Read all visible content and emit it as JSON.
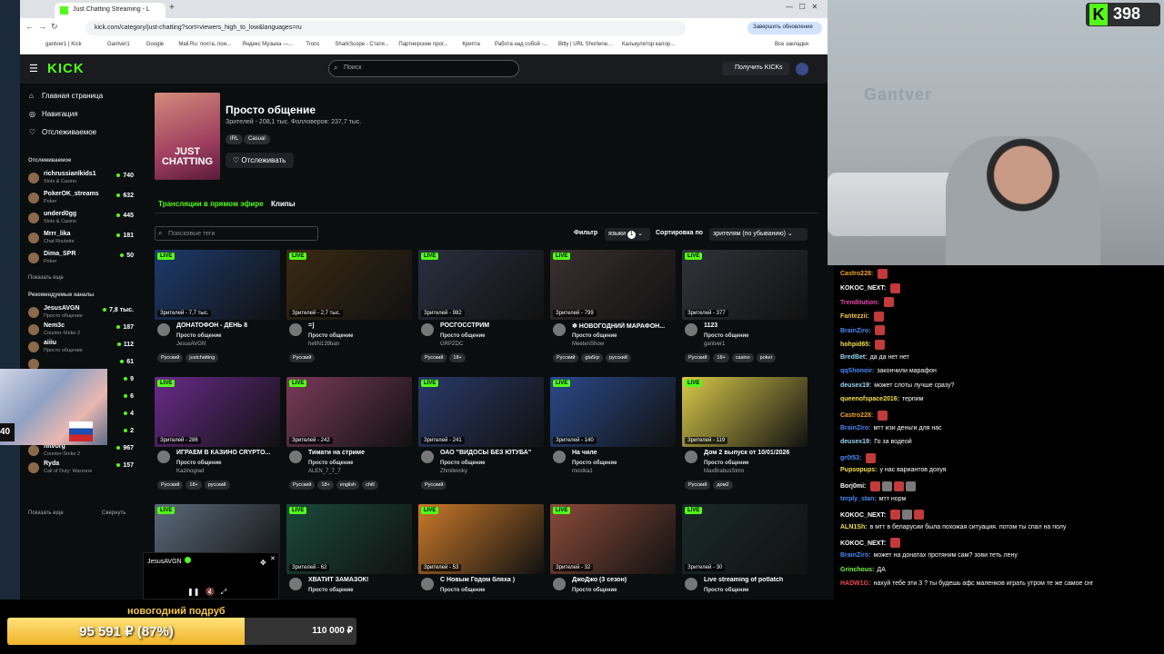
{
  "browser": {
    "tab_title": "Just Chatting Streaming - L",
    "url": "kick.com/category/just-chatting?sort=viewers_high_to_low&languages=ru",
    "update_btn": "Завершить обновление",
    "bookmarks": [
      "gantver1 | Kick",
      "Gantver1",
      "Google",
      "Mail.Ru: почта, пои...",
      "Яндекс Музыка —...",
      "Tronc",
      "SharkScope - Стати...",
      "Партнерские прог...",
      "Крипта",
      "Работа над собой -...",
      "Bitly | URL Shortene...",
      "Калькулятор калор...",
      "Все закладки"
    ]
  },
  "kick": {
    "logo": "KICK",
    "search_placeholder": "Поиск",
    "get_kicks": "Получить KICKs",
    "nav": [
      {
        "icon": "home-icon",
        "label": "Главная страница"
      },
      {
        "icon": "compass-icon",
        "label": "Навигация"
      },
      {
        "icon": "heart-icon",
        "label": "Отслеживаемое"
      }
    ],
    "followed_head": "Отслеживаемое",
    "followed": [
      {
        "name": "richrussianlkids1",
        "cat": "Slots & Casino",
        "viewers": "740"
      },
      {
        "name": "PokerOK_streams",
        "cat": "Poker",
        "viewers": "632"
      },
      {
        "name": "underd0gg",
        "cat": "Slots & Casino",
        "viewers": "445"
      },
      {
        "name": "Mrrr_lika",
        "cat": "Chat Roulette",
        "viewers": "181"
      },
      {
        "name": "Dima_SPR",
        "cat": "Poker",
        "viewers": "50"
      }
    ],
    "show_more": "Показать еще",
    "recommended_head": "Рекомендуемые каналы",
    "recommended": [
      {
        "name": "JesusAVGN",
        "cat": "Просто общение",
        "viewers": "7,8 тыс."
      },
      {
        "name": "Nem3c",
        "cat": "Counter-Strike 2",
        "viewers": "187"
      },
      {
        "name": "aiiiu",
        "cat": "Просто общение",
        "viewers": "112"
      },
      {
        "name": "",
        "cat": "",
        "viewers": "61"
      },
      {
        "name": "",
        "cat": "",
        "viewers": "9"
      },
      {
        "name": "",
        "cat": "",
        "viewers": "6"
      },
      {
        "name": "",
        "cat": "",
        "viewers": "4"
      },
      {
        "name": "IGORYAMBA999",
        "cat": "Counter-Strike 2",
        "viewers": "2"
      },
      {
        "name": "hltvorg",
        "cat": "Counter-Strike 2",
        "viewers": "967"
      },
      {
        "name": "Ryda",
        "cat": "Call of Duty: Warzone",
        "viewers": "157"
      }
    ],
    "show_more2": "Показать еще",
    "collapse": "Свернуть",
    "category": {
      "title": "Просто общение",
      "stats": "Зрителей - 208,1 тыс.   Фолловеров: 237,7 тыс.",
      "tags": [
        "IRL",
        "Casual"
      ],
      "image_text": "JUST CHATTING",
      "follow_btn": "Отслеживать"
    },
    "tabs": {
      "live": "Трансляции в прямом эфире",
      "clips": "Клипы"
    },
    "tag_search_placeholder": "Поисковые теги",
    "filter_label": "Фильтр",
    "lang_btn": "языки",
    "lang_count": "1",
    "sort_label": "Сортировка по",
    "sort_value": "зрителям (по убыванию)",
    "live_badge": "LIVE",
    "cards": [
      {
        "viewers": "Зрителей - 7,7 тыс.",
        "title": "ДОНАТОФОН - ДЕНЬ 8",
        "cat": "Просто общение",
        "user": "JesusAVGN",
        "tags": [
          "Русский",
          "justchatting"
        ],
        "bg": "#1d3b6e"
      },
      {
        "viewers": "Зрителей - 2,7 тыс.",
        "title": "=]",
        "cat": "Просто общение",
        "user": "helIN139ban",
        "tags": [
          "Русский"
        ],
        "bg": "#3a2a12"
      },
      {
        "viewers": "Зрителей - 982",
        "title": "РОСГОССТРИМ",
        "cat": "Просто общение",
        "user": "GRPZDC",
        "tags": [
          "Русский",
          "18+"
        ],
        "bg": "#2a3040"
      },
      {
        "viewers": "Зрителей - 799",
        "title": "❄ НОВОГОДНИЙ МАРАФОН...",
        "cat": "Просто общение",
        "user": "MeetenShow",
        "tags": [
          "Русский",
          "gta5rp",
          "русский"
        ],
        "bg": "#3a3030"
      },
      {
        "viewers": "Зрителей - 377",
        "title": "1123",
        "cat": "Просто общение",
        "user": "gantver1",
        "tags": [
          "Русский",
          "18+",
          "casino",
          "poker"
        ],
        "bg": "#30343a"
      },
      {
        "viewers": "Зрителей - 286",
        "title": "ИГРАЕМ В КАЗИНО CRYPTO...",
        "cat": "Просто общение",
        "user": "Kazinograd",
        "tags": [
          "Русский",
          "18+",
          "русский"
        ],
        "bg": "#6a2a8a"
      },
      {
        "viewers": "Зрителей - 242",
        "title": "Тимати на стриме",
        "cat": "Просто общение",
        "user": "ALEN_7_7_7",
        "tags": [
          "Русский",
          "18+",
          "english",
          "chill"
        ],
        "bg": "#7a3a5a"
      },
      {
        "viewers": "Зрителей - 241",
        "title": "ОАО \"ВИДОСЫ БЕЗ ЮТУБА\"",
        "cat": "Просто общение",
        "user": "Zhmilevsky",
        "tags": [
          "Русский"
        ],
        "bg": "#2a3a6a"
      },
      {
        "viewers": "Зрителей - 140",
        "title": "На чиле",
        "cat": "Просто общение",
        "user": "mostka1",
        "tags": [],
        "bg": "#2a4a8a"
      },
      {
        "viewers": "Зрителей - 119",
        "title": "Дом 2 выпуск от 10/01/2026",
        "cat": "Просто общение",
        "user": "MaxBrabusStrim",
        "tags": [
          "Русский",
          "дом2"
        ],
        "bg": "#d8c84a"
      },
      {
        "viewers": "",
        "title": "",
        "cat": "",
        "user": "",
        "tags": [],
        "bg": "#5a6a7a"
      },
      {
        "viewers": "Зрителей - 62",
        "title": "ХВАТИТ ЗАМАЗОК!",
        "cat": "Просто общение",
        "user": "",
        "tags": [],
        "bg": "#1a4a3a"
      },
      {
        "viewers": "Зрителей - 53",
        "title": "С Новым Годом бляха )",
        "cat": "Просто общение",
        "user": "",
        "tags": [],
        "bg": "#c8782a"
      },
      {
        "viewers": "Зрителей - 32",
        "title": "ДжоДжо (3 сезон)",
        "cat": "Просто общение",
        "user": "",
        "tags": [],
        "bg": "#8a4a3a"
      },
      {
        "viewers": "Зрителей - 30",
        "title": "Live streaming of potlatch",
        "cat": "Просто общение",
        "user": "",
        "tags": [],
        "bg": "#1a2a2a"
      }
    ],
    "mini_player_name": "JesusAVGN"
  },
  "overlay": {
    "kick_count": "398",
    "wall_text": "Gantver",
    "cam2_num": "40",
    "goal_label": "новогодний подруб",
    "goal_progress": "95 591 ₽ (87%)",
    "goal_fraction": 0.87,
    "goal_target": "110 000 ₽"
  },
  "chat": [
    {
      "user": "Castro228:",
      "text": "",
      "color": "#f5a623",
      "emotes": 1
    },
    {
      "user": "KOKOC_NEXT:",
      "text": "",
      "color": "#ffffff",
      "emotes": 1
    },
    {
      "user": "Trenditution:",
      "text": "",
      "color": "#e84ab0",
      "emotes": 1
    },
    {
      "user": "Fantezzii:",
      "text": "",
      "color": "#f5c84a",
      "emotes": 1
    },
    {
      "user": "BrainZiro:",
      "text": "",
      "color": "#4a8af5",
      "emotes": 1
    },
    {
      "user": "hohpid65:",
      "text": "",
      "color": "#f5e04a",
      "emotes": 1
    },
    {
      "user": "BredBet:",
      "text": "да да нет нет",
      "color": "#9ad8f5",
      "emotes": 0
    },
    {
      "user": "qqShonoir:",
      "text": "закончили марафон",
      "color": "#4a8af5",
      "emotes": 0
    },
    {
      "user": "deusex19:",
      "text": "может слоты лучше сразу?",
      "color": "#9ad8f5",
      "emotes": 0
    },
    {
      "user": "queenofspace2016:",
      "text": "терпим",
      "color": "#f5e04a",
      "emotes": 0
    },
    {
      "user": "Castro228:",
      "text": "",
      "color": "#f5a623",
      "emotes": 1
    },
    {
      "user": "BrainZiro:",
      "text": "мтт изи деньги для нас",
      "color": "#4a8af5",
      "emotes": 0
    },
    {
      "user": "deusex19:",
      "text": "Го за водеой",
      "color": "#9ad8f5",
      "emotes": 0
    },
    {
      "user": "gr0t53:",
      "text": "",
      "color": "#4a8af5",
      "emotes": 1
    },
    {
      "user": "Pupsopups:",
      "text": "у нас вариантов доxуя",
      "color": "#f5e04a",
      "emotes": 0
    },
    {
      "user": "Borj0mi:",
      "text": "",
      "color": "#ffffff",
      "emotes": 4
    },
    {
      "user": "terply_stan:",
      "text": "мтт норм",
      "color": "#4a8af5",
      "emotes": 0
    },
    {
      "user": "KOKOC_NEXT:",
      "text": "",
      "color": "#ffffff",
      "emotes": 3
    },
    {
      "user": "ALN1Sh:",
      "text": "в мтт в беларусии была похожая ситуация. потом ты спал на полу",
      "color": "#f5e04a",
      "emotes": 0
    },
    {
      "user": "KOKOC_NEXT:",
      "text": "",
      "color": "#ffffff",
      "emotes": 1
    },
    {
      "user": "BrainZiro:",
      "text": "может на донатах протяним сам? зови теть лену",
      "color": "#4a8af5",
      "emotes": 0
    },
    {
      "user": "Grinchous:",
      "text": "ДА",
      "color": "#7af54a",
      "emotes": 0
    },
    {
      "user": "HADW1G:",
      "text": "нахуй тебе эти 3 ? ты будешь афс маленков играть утром те же самое снг",
      "color": "#f54a4a",
      "emotes": 0
    }
  ]
}
